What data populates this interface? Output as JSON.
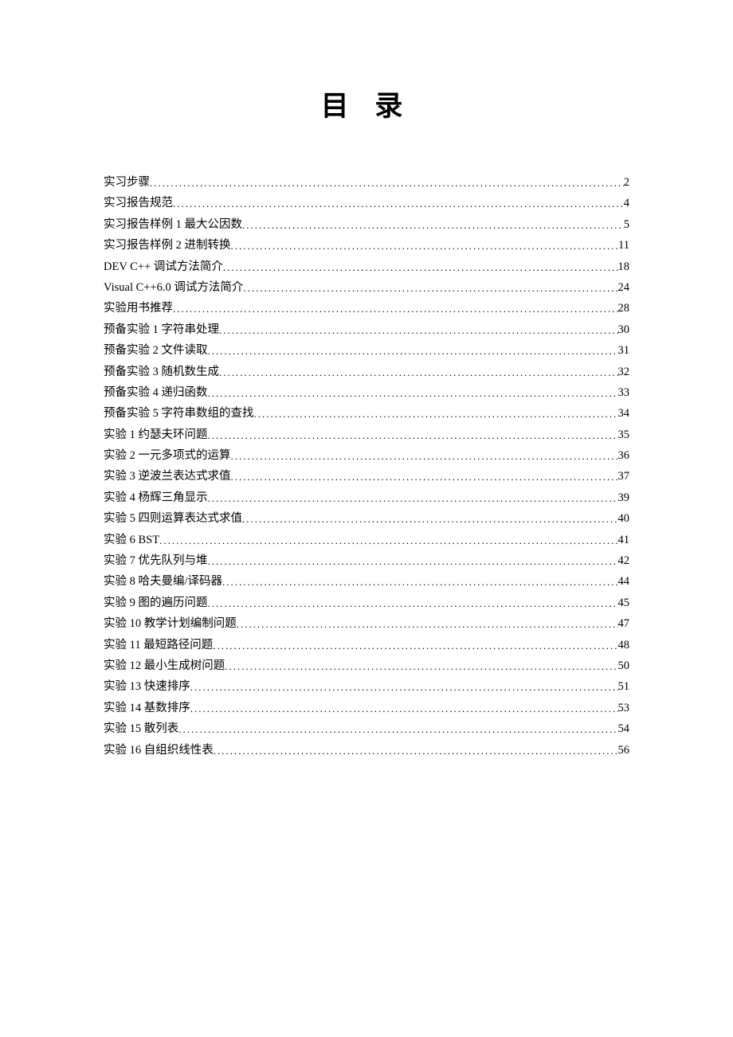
{
  "title": "目 录",
  "toc": [
    {
      "label": "实习步骤",
      "page": "2"
    },
    {
      "label": "实习报告规范",
      "page": "4"
    },
    {
      "label": "实习报告样例 1 最大公因数",
      "page": "5"
    },
    {
      "label": "实习报告样例 2  进制转换",
      "page": "11"
    },
    {
      "label": "DEV C++  调试方法简介",
      "page": "18"
    },
    {
      "label": "Visual C++6.0 调试方法简介",
      "page": "24"
    },
    {
      "label": "实验用书推荐",
      "page": "28"
    },
    {
      "label": "预备实验 1  字符串处理",
      "page": "30"
    },
    {
      "label": "预备实验 2  文件读取",
      "page": "31"
    },
    {
      "label": "预备实验 3  随机数生成",
      "page": "32"
    },
    {
      "label": "预备实验 4  递归函数",
      "page": "33"
    },
    {
      "label": "预备实验 5  字符串数组的查找",
      "page": "34"
    },
    {
      "label": "实验 1 约瑟夫环问题",
      "page": "35"
    },
    {
      "label": "实验 2  一元多项式的运算",
      "page": "36"
    },
    {
      "label": "实验 3  逆波兰表达式求值",
      "page": "37"
    },
    {
      "label": "实验 4  杨辉三角显示",
      "page": "39"
    },
    {
      "label": "实验 5 四则运算表达式求值",
      "page": "40"
    },
    {
      "label": "实验 6 BST",
      "page": "41"
    },
    {
      "label": "实验 7  优先队列与堆",
      "page": "42"
    },
    {
      "label": "实验 8  哈夫曼编/译码器",
      "page": "44"
    },
    {
      "label": "实验 9  图的遍历问题",
      "page": "45"
    },
    {
      "label": "实验 10  教学计划编制问题",
      "page": "47"
    },
    {
      "label": "实验 11  最短路径问题",
      "page": "48"
    },
    {
      "label": "实验 12  最小生成树问题",
      "page": "50"
    },
    {
      "label": "实验 13  快速排序",
      "page": "51"
    },
    {
      "label": "实验 14  基数排序",
      "page": "53"
    },
    {
      "label": "实验 15  散列表",
      "page": "54"
    },
    {
      "label": "实验 16  自组织线性表",
      "page": "56"
    }
  ]
}
